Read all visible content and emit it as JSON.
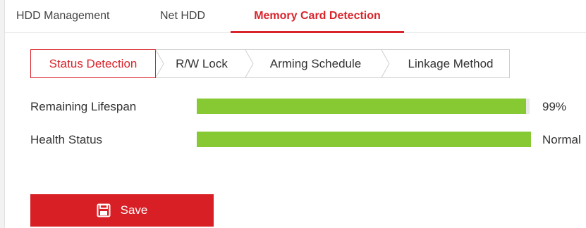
{
  "top_tabs": [
    {
      "label": "HDD Management",
      "active": false
    },
    {
      "label": "Net HDD",
      "active": false
    },
    {
      "label": "Memory Card Detection",
      "active": true
    }
  ],
  "sub_tabs": [
    {
      "label": "Status Detection",
      "active": true
    },
    {
      "label": "R/W Lock",
      "active": false
    },
    {
      "label": "Arming Schedule",
      "active": false
    },
    {
      "label": "Linkage Method",
      "active": false
    }
  ],
  "status": {
    "lifespan": {
      "label": "Remaining Lifespan",
      "value_text": "99%",
      "fill_percent": 99
    },
    "health": {
      "label": "Health Status",
      "value_text": "Normal",
      "fill_percent": 100
    }
  },
  "save_button": {
    "label": "Save",
    "icon": "floppy-disk-icon"
  },
  "colors": {
    "accent": "#d9242b",
    "bar": "#86c932",
    "button": "#d81f26"
  }
}
